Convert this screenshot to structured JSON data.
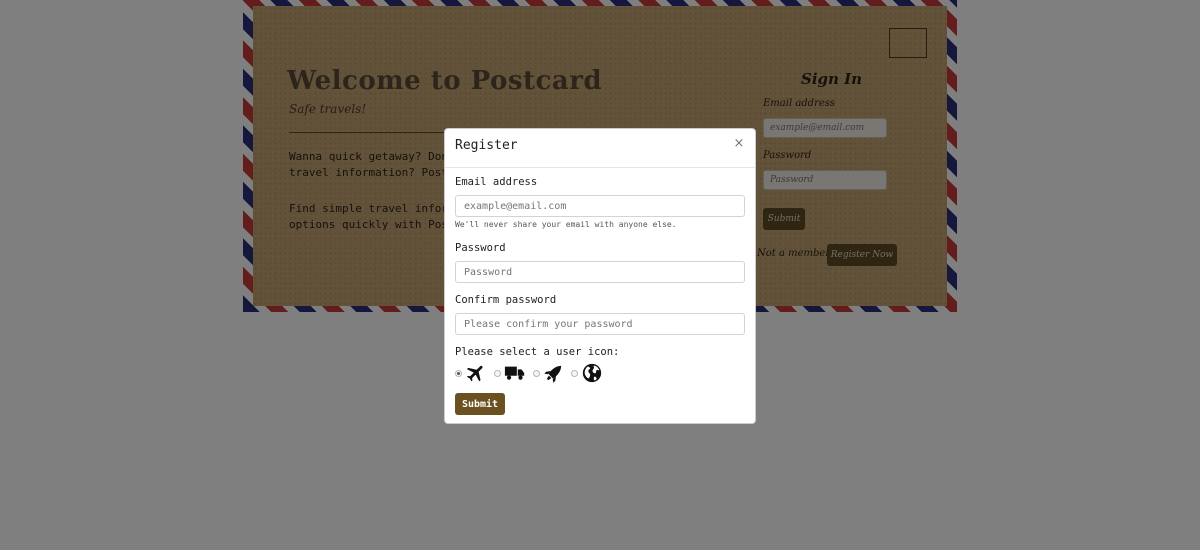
{
  "postcard": {
    "title": "Welcome to Postcard",
    "tagline": "Safe travels!",
    "para1_line1": "Wanna quick getaway? Don't feel",
    "para1_line2": "travel information? Postcard",
    "para2_line1": "Find simple travel information",
    "para2_line2": "options quickly with Postcard"
  },
  "signin": {
    "title": "Sign In",
    "email_label": "Email address",
    "email_placeholder": "example@email.com",
    "password_label": "Password",
    "password_placeholder": "Password",
    "submit_label": "Submit",
    "member_text": "Not a member?",
    "register_label": "Register Now"
  },
  "modal": {
    "title": "Register",
    "close_label": "×",
    "email_label": "Email address",
    "email_placeholder": "example@email.com",
    "email_help": "We'll never share your email with anyone else.",
    "password_label": "Password",
    "password_placeholder": "Password",
    "confirm_label": "Confirm password",
    "confirm_placeholder": "Please confirm your password",
    "icon_prompt": "Please select a user icon:",
    "icon_options": [
      {
        "icon": "airplane-icon",
        "selected": true
      },
      {
        "icon": "truck-icon",
        "selected": false
      },
      {
        "icon": "rocket-icon",
        "selected": false
      },
      {
        "icon": "globe-icon",
        "selected": false
      }
    ],
    "submit_label": "Submit"
  },
  "colors": {
    "airmail_blue": "#2b2f78",
    "airmail_red": "#c63a3a",
    "kraft": "#c7a574",
    "brown_button": "#6b5020"
  }
}
